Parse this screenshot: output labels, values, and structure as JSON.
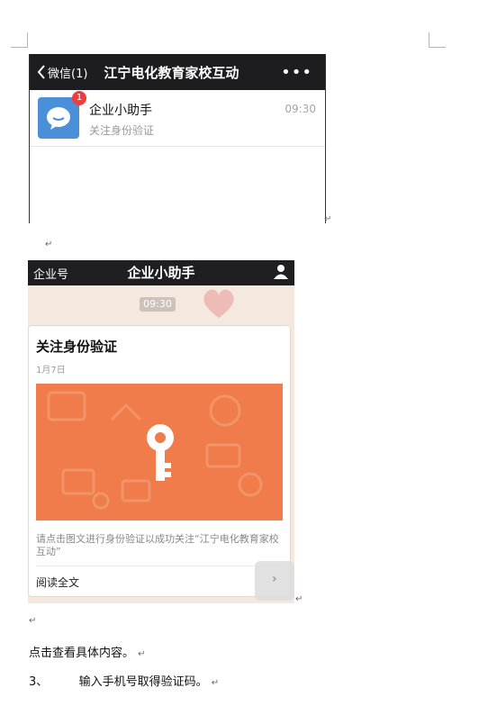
{
  "doc": {
    "para_mark": "↵",
    "after_images_text": "点击查看具体内容。",
    "step_number": "3、",
    "step_text": "输入手机号取得验证码。"
  },
  "screenshot1": {
    "back_label": "微信(1)",
    "title": "江宁电化教育家校互动",
    "more": "•••",
    "chat": {
      "name": "企业小助手",
      "preview": "关注身份验证",
      "time": "09:30",
      "badge": "1"
    }
  },
  "screenshot2": {
    "left_label": "企业号",
    "title": "企业小助手",
    "time_chip": "09:30",
    "card": {
      "title": "关注身份验证",
      "date": "1月7日",
      "description": "请点击图文进行身份验证以成功关注“江宁电化教育家校互动”",
      "read_more": "阅读全文"
    },
    "next": "›"
  },
  "colors": {
    "navbar": "#1d1d1f",
    "avatar": "#4a90d9",
    "badge": "#f23c3c",
    "card_image": "#ef7c4a",
    "chat_bg": "#f4e8df"
  },
  "icons": [
    "back-chevron-icon",
    "more-dots-icon",
    "chat-bubble-icon",
    "user-icon",
    "key-icon",
    "chevron-right-icon"
  ]
}
